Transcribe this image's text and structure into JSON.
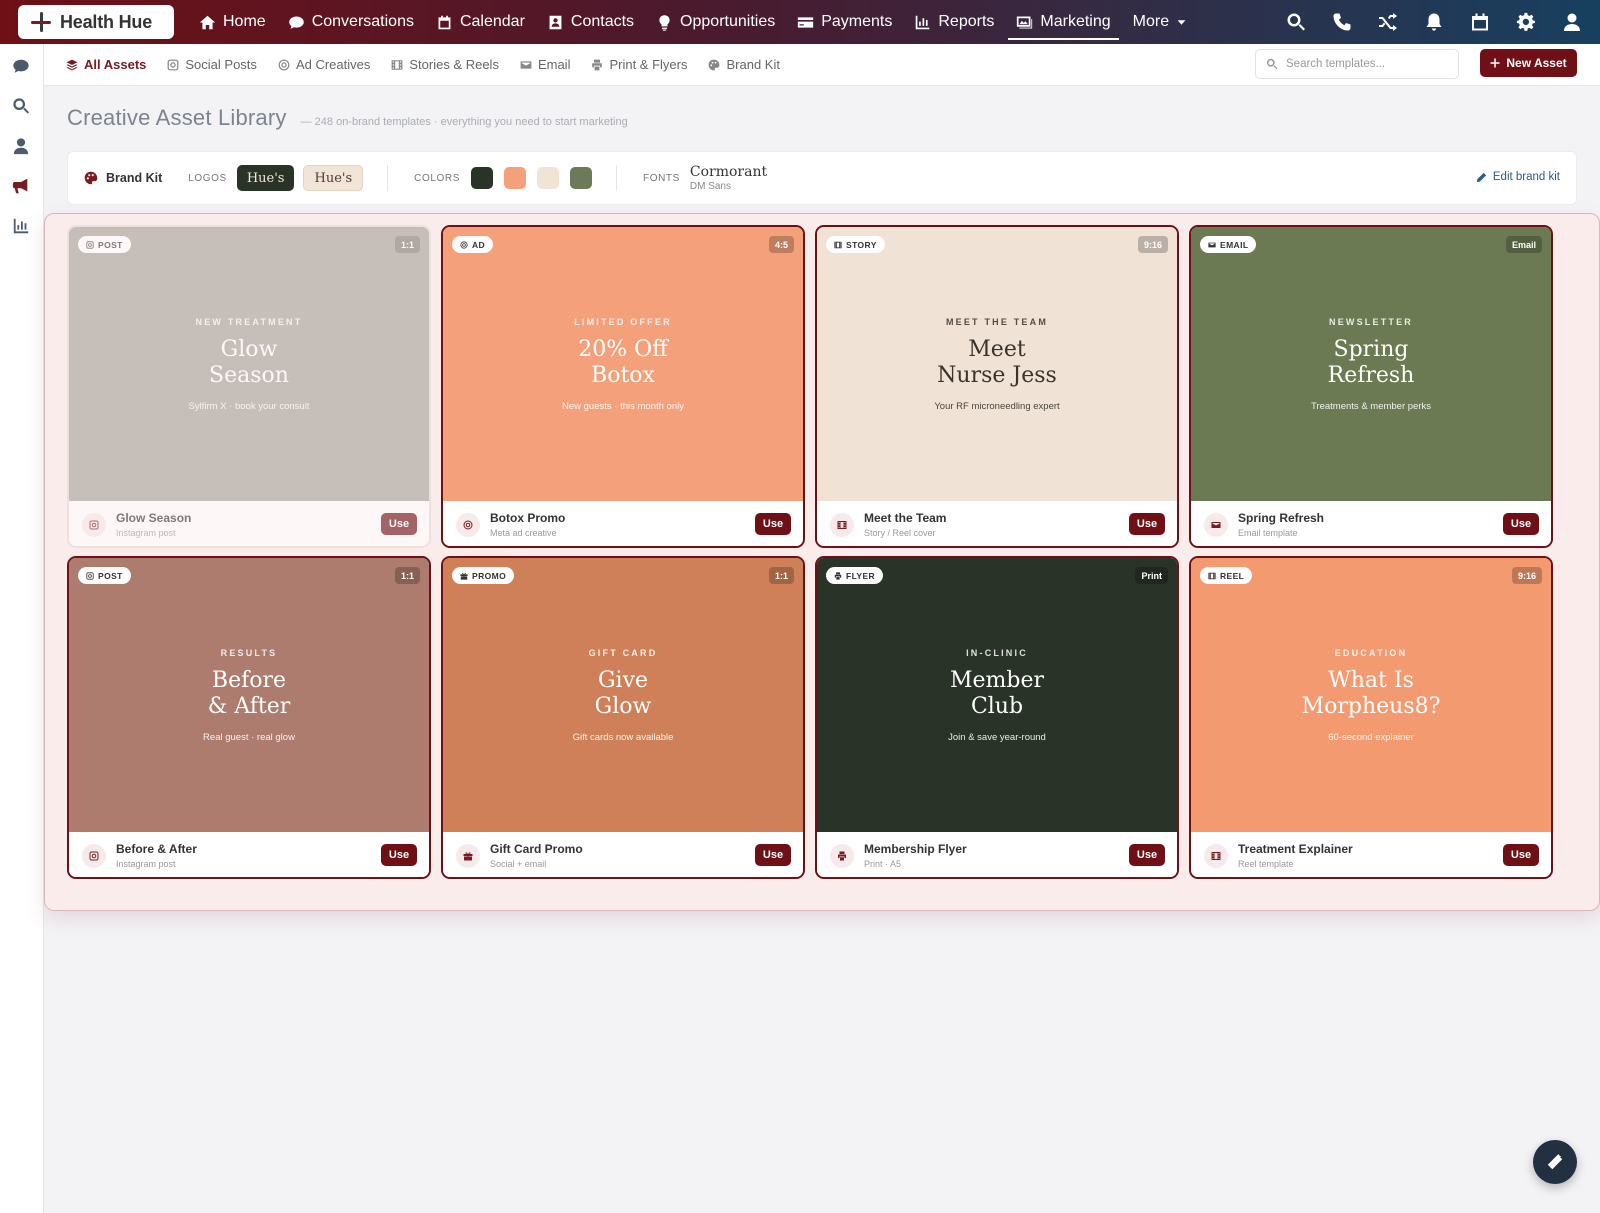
{
  "app": {
    "name": "Health Hue"
  },
  "nav": {
    "items": [
      {
        "label": "Home",
        "icon": "home-icon"
      },
      {
        "label": "Conversations",
        "icon": "chat-icon"
      },
      {
        "label": "Calendar",
        "icon": "calendar-icon"
      },
      {
        "label": "Contacts",
        "icon": "contacts-icon"
      },
      {
        "label": "Opportunities",
        "icon": "lightbulb-icon"
      },
      {
        "label": "Payments",
        "icon": "card-icon"
      },
      {
        "label": "Reports",
        "icon": "chart-icon"
      },
      {
        "label": "Marketing",
        "icon": "image-icon"
      },
      {
        "label": "More",
        "icon": "caret-down-icon"
      }
    ],
    "active": "Marketing"
  },
  "subnav": {
    "tabs": [
      {
        "label": "All Assets",
        "icon": "layers-icon"
      },
      {
        "label": "Social Posts",
        "icon": "instagram-icon"
      },
      {
        "label": "Ad Creatives",
        "icon": "target-icon"
      },
      {
        "label": "Stories & Reels",
        "icon": "film-icon"
      },
      {
        "label": "Email",
        "icon": "email-icon"
      },
      {
        "label": "Print & Flyers",
        "icon": "print-icon"
      },
      {
        "label": "Brand Kit",
        "icon": "palette-icon"
      }
    ],
    "active": "All Assets",
    "search_placeholder": "Search templates...",
    "new_asset_label": "New Asset"
  },
  "page": {
    "title": "Creative Asset Library",
    "subtitle": "— 248 on-brand templates · everything you need to start marketing"
  },
  "brand_kit": {
    "title": "Brand Kit",
    "logos_label": "LOGOS",
    "logo_dark": "Hue's",
    "logo_light": "Hue's",
    "colors_label": "COLORS",
    "colors": [
      "#2a3328",
      "#f4a07a",
      "#f1e4d6",
      "#6c7a5a"
    ],
    "fonts_label": "FONTS",
    "font_primary": "Cormorant",
    "font_secondary": "DM Sans",
    "edit_label": "Edit brand kit"
  },
  "cards": [
    {
      "badge": "POST",
      "ratio": "1:1",
      "kicker": "NEW TREATMENT",
      "headline": "Glow\nSeason",
      "sub": "Sylfirm X · book your consult",
      "name": "Glow Season",
      "type": "Instagram post",
      "use": "Use",
      "bg": "#a6a39a",
      "fg": "#ffffff"
    },
    {
      "badge": "AD",
      "ratio": "4:5",
      "kicker": "LIMITED OFFER",
      "headline": "20% Off\nBotox",
      "sub": "New guests · this month only",
      "name": "Botox Promo",
      "type": "Meta ad creative",
      "use": "Use",
      "bg": "#f4a07a",
      "fg": "#ffffff"
    },
    {
      "badge": "STORY",
      "ratio": "9:16",
      "kicker": "MEET THE TEAM",
      "headline": "Meet\nNurse Jess",
      "sub": "Your RF microneedling expert",
      "name": "Meet the Team",
      "type": "Story / Reel cover",
      "use": "Use",
      "bg": "#f0e2d4",
      "fg": "#3a332c"
    },
    {
      "badge": "EMAIL",
      "ratio": "Email",
      "kicker": "NEWSLETTER",
      "headline": "Spring\nRefresh",
      "sub": "Treatments & member perks",
      "name": "Spring Refresh",
      "type": "Email template",
      "use": "Use",
      "bg": "#6b7a52",
      "fg": "#ffffff"
    },
    {
      "badge": "POST",
      "ratio": "1:1",
      "kicker": "RESULTS",
      "headline": "Before\n& After",
      "sub": "Real guest · real glow",
      "name": "Before & After",
      "type": "Instagram post",
      "use": "Use",
      "bg": "#ad7c6e",
      "fg": "#ffffff"
    },
    {
      "badge": "PROMO",
      "ratio": "1:1",
      "kicker": "GIFT CARD",
      "headline": "Give\nGlow",
      "sub": "Gift cards now available",
      "name": "Gift Card Promo",
      "type": "Social + email",
      "use": "Use",
      "bg": "#cf8058",
      "fg": "#ffffff"
    },
    {
      "badge": "FLYER",
      "ratio": "Print",
      "kicker": "IN-CLINIC",
      "headline": "Member\nClub",
      "sub": "Join & save year-round",
      "name": "Membership Flyer",
      "type": "Print · A5",
      "use": "Use",
      "bg": "#2a3328",
      "fg": "#ffffff"
    },
    {
      "badge": "REEL",
      "ratio": "9:16",
      "kicker": "EDUCATION",
      "headline": "What Is\nMorpheus8?",
      "sub": "60-second explainer",
      "name": "Treatment Explainer",
      "type": "Reel template",
      "use": "Use",
      "bg": "#f39a70",
      "fg": "#ffffff"
    }
  ]
}
